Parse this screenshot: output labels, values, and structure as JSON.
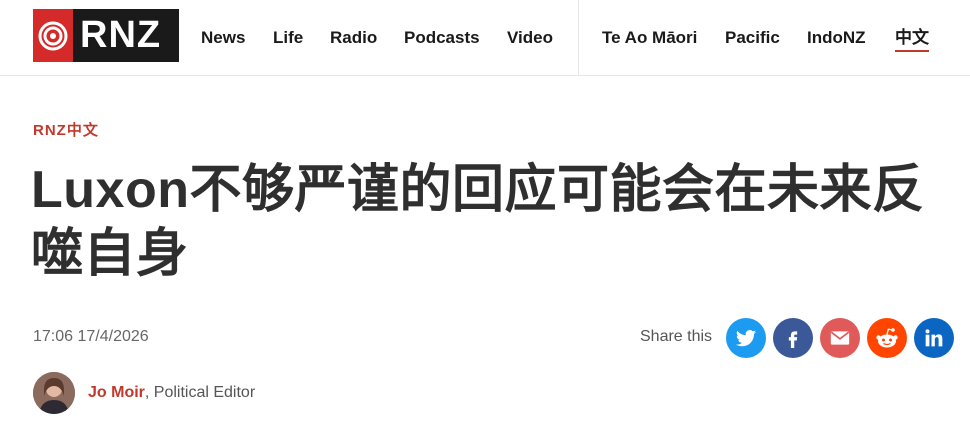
{
  "header": {
    "logo_text": "RNZ",
    "nav_primary": [
      "News",
      "Life",
      "Radio",
      "Podcasts",
      "Video"
    ],
    "nav_secondary": [
      "Te Ao Māori",
      "Pacific",
      "IndoNZ",
      "中文"
    ]
  },
  "article": {
    "kicker": "RNZ中文",
    "headline": "Luxon不够严谨的回应可能会在未来反噬自身",
    "timestamp": "17:06 17/4/2026",
    "share_label": "Share this",
    "author_name": "Jo Moir",
    "author_role": ", Political Editor"
  },
  "colors": {
    "twitter": "#1d9bf0",
    "facebook": "#3b5998",
    "email": "#e05a5a",
    "reddit": "#ff4500",
    "linkedin": "#0a66c2",
    "accent": "#c0392b"
  },
  "icons": [
    "twitter-icon",
    "facebook-icon",
    "email-icon",
    "reddit-icon",
    "linkedin-icon"
  ]
}
